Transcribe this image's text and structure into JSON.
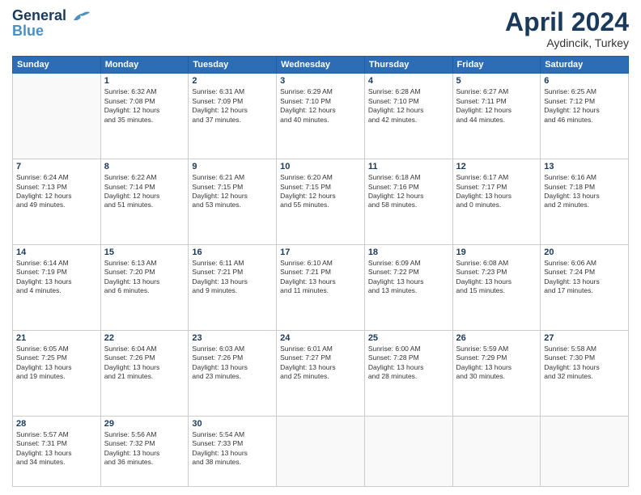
{
  "header": {
    "logo_line1": "General",
    "logo_line2": "Blue",
    "month": "April 2024",
    "location": "Aydincik, Turkey"
  },
  "weekdays": [
    "Sunday",
    "Monday",
    "Tuesday",
    "Wednesday",
    "Thursday",
    "Friday",
    "Saturday"
  ],
  "weeks": [
    [
      {
        "day": "",
        "sunrise": "",
        "sunset": "",
        "daylight": ""
      },
      {
        "day": "1",
        "sunrise": "Sunrise: 6:32 AM",
        "sunset": "Sunset: 7:08 PM",
        "daylight": "Daylight: 12 hours and 35 minutes."
      },
      {
        "day": "2",
        "sunrise": "Sunrise: 6:31 AM",
        "sunset": "Sunset: 7:09 PM",
        "daylight": "Daylight: 12 hours and 37 minutes."
      },
      {
        "day": "3",
        "sunrise": "Sunrise: 6:29 AM",
        "sunset": "Sunset: 7:10 PM",
        "daylight": "Daylight: 12 hours and 40 minutes."
      },
      {
        "day": "4",
        "sunrise": "Sunrise: 6:28 AM",
        "sunset": "Sunset: 7:10 PM",
        "daylight": "Daylight: 12 hours and 42 minutes."
      },
      {
        "day": "5",
        "sunrise": "Sunrise: 6:27 AM",
        "sunset": "Sunset: 7:11 PM",
        "daylight": "Daylight: 12 hours and 44 minutes."
      },
      {
        "day": "6",
        "sunrise": "Sunrise: 6:25 AM",
        "sunset": "Sunset: 7:12 PM",
        "daylight": "Daylight: 12 hours and 46 minutes."
      }
    ],
    [
      {
        "day": "7",
        "sunrise": "Sunrise: 6:24 AM",
        "sunset": "Sunset: 7:13 PM",
        "daylight": "Daylight: 12 hours and 49 minutes."
      },
      {
        "day": "8",
        "sunrise": "Sunrise: 6:22 AM",
        "sunset": "Sunset: 7:14 PM",
        "daylight": "Daylight: 12 hours and 51 minutes."
      },
      {
        "day": "9",
        "sunrise": "Sunrise: 6:21 AM",
        "sunset": "Sunset: 7:15 PM",
        "daylight": "Daylight: 12 hours and 53 minutes."
      },
      {
        "day": "10",
        "sunrise": "Sunrise: 6:20 AM",
        "sunset": "Sunset: 7:15 PM",
        "daylight": "Daylight: 12 hours and 55 minutes."
      },
      {
        "day": "11",
        "sunrise": "Sunrise: 6:18 AM",
        "sunset": "Sunset: 7:16 PM",
        "daylight": "Daylight: 12 hours and 58 minutes."
      },
      {
        "day": "12",
        "sunrise": "Sunrise: 6:17 AM",
        "sunset": "Sunset: 7:17 PM",
        "daylight": "Daylight: 13 hours and 0 minutes."
      },
      {
        "day": "13",
        "sunrise": "Sunrise: 6:16 AM",
        "sunset": "Sunset: 7:18 PM",
        "daylight": "Daylight: 13 hours and 2 minutes."
      }
    ],
    [
      {
        "day": "14",
        "sunrise": "Sunrise: 6:14 AM",
        "sunset": "Sunset: 7:19 PM",
        "daylight": "Daylight: 13 hours and 4 minutes."
      },
      {
        "day": "15",
        "sunrise": "Sunrise: 6:13 AM",
        "sunset": "Sunset: 7:20 PM",
        "daylight": "Daylight: 13 hours and 6 minutes."
      },
      {
        "day": "16",
        "sunrise": "Sunrise: 6:11 AM",
        "sunset": "Sunset: 7:21 PM",
        "daylight": "Daylight: 13 hours and 9 minutes."
      },
      {
        "day": "17",
        "sunrise": "Sunrise: 6:10 AM",
        "sunset": "Sunset: 7:21 PM",
        "daylight": "Daylight: 13 hours and 11 minutes."
      },
      {
        "day": "18",
        "sunrise": "Sunrise: 6:09 AM",
        "sunset": "Sunset: 7:22 PM",
        "daylight": "Daylight: 13 hours and 13 minutes."
      },
      {
        "day": "19",
        "sunrise": "Sunrise: 6:08 AM",
        "sunset": "Sunset: 7:23 PM",
        "daylight": "Daylight: 13 hours and 15 minutes."
      },
      {
        "day": "20",
        "sunrise": "Sunrise: 6:06 AM",
        "sunset": "Sunset: 7:24 PM",
        "daylight": "Daylight: 13 hours and 17 minutes."
      }
    ],
    [
      {
        "day": "21",
        "sunrise": "Sunrise: 6:05 AM",
        "sunset": "Sunset: 7:25 PM",
        "daylight": "Daylight: 13 hours and 19 minutes."
      },
      {
        "day": "22",
        "sunrise": "Sunrise: 6:04 AM",
        "sunset": "Sunset: 7:26 PM",
        "daylight": "Daylight: 13 hours and 21 minutes."
      },
      {
        "day": "23",
        "sunrise": "Sunrise: 6:03 AM",
        "sunset": "Sunset: 7:26 PM",
        "daylight": "Daylight: 13 hours and 23 minutes."
      },
      {
        "day": "24",
        "sunrise": "Sunrise: 6:01 AM",
        "sunset": "Sunset: 7:27 PM",
        "daylight": "Daylight: 13 hours and 25 minutes."
      },
      {
        "day": "25",
        "sunrise": "Sunrise: 6:00 AM",
        "sunset": "Sunset: 7:28 PM",
        "daylight": "Daylight: 13 hours and 28 minutes."
      },
      {
        "day": "26",
        "sunrise": "Sunrise: 5:59 AM",
        "sunset": "Sunset: 7:29 PM",
        "daylight": "Daylight: 13 hours and 30 minutes."
      },
      {
        "day": "27",
        "sunrise": "Sunrise: 5:58 AM",
        "sunset": "Sunset: 7:30 PM",
        "daylight": "Daylight: 13 hours and 32 minutes."
      }
    ],
    [
      {
        "day": "28",
        "sunrise": "Sunrise: 5:57 AM",
        "sunset": "Sunset: 7:31 PM",
        "daylight": "Daylight: 13 hours and 34 minutes."
      },
      {
        "day": "29",
        "sunrise": "Sunrise: 5:56 AM",
        "sunset": "Sunset: 7:32 PM",
        "daylight": "Daylight: 13 hours and 36 minutes."
      },
      {
        "day": "30",
        "sunrise": "Sunrise: 5:54 AM",
        "sunset": "Sunset: 7:33 PM",
        "daylight": "Daylight: 13 hours and 38 minutes."
      },
      {
        "day": "",
        "sunrise": "",
        "sunset": "",
        "daylight": ""
      },
      {
        "day": "",
        "sunrise": "",
        "sunset": "",
        "daylight": ""
      },
      {
        "day": "",
        "sunrise": "",
        "sunset": "",
        "daylight": ""
      },
      {
        "day": "",
        "sunrise": "",
        "sunset": "",
        "daylight": ""
      }
    ]
  ]
}
